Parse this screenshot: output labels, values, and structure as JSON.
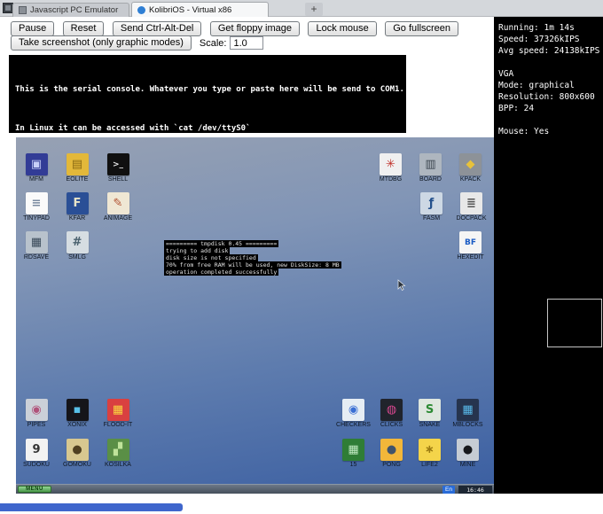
{
  "browser": {
    "tabs": [
      {
        "label": "Javascript PC Emulator",
        "active": false
      },
      {
        "label": "KolibriOS - Virtual x86",
        "active": true
      }
    ],
    "new_tab_label": "+"
  },
  "toolbar": {
    "pause": "Pause",
    "reset": "Reset",
    "send_cad": "Send Ctrl-Alt-Del",
    "get_floppy": "Get floppy image",
    "lock_mouse": "Lock mouse",
    "go_fullscreen": "Go fullscreen",
    "take_screenshot": "Take screenshot (only graphic modes)",
    "scale_label": "Scale:",
    "scale_value": "1.0"
  },
  "serial_console": {
    "line1": "This is the serial console. Whatever you type or paste here will be send to COM1.",
    "line2": "In Linux it can be accessed with `cat /dev/ttyS0`"
  },
  "stats": {
    "running": "Running: 1m 14s",
    "speed": "Speed: 37326kIPS",
    "avg_speed": "Avg speed: 24138kIPS",
    "vga_header": "VGA",
    "mode": "Mode: graphical",
    "resolution": "Resolution: 800x600",
    "bpp": "BPP: 24",
    "mouse": "Mouse: Yes"
  },
  "desktop": {
    "boot_messages": [
      "========= tmpdisk 0.45 =========",
      "trying to add disk",
      "disk size is not specified",
      "70% from free RAM will be used, new DiskSize: 8 MB",
      "operation completed successfully"
    ],
    "icon_groups": {
      "top_left": [
        {
          "label": "MFM",
          "icon": "floppy",
          "glyph": "▣",
          "bg": "#323c96",
          "fg": "#c8d0f8"
        },
        {
          "label": "EOLITE",
          "icon": "folder",
          "glyph": "▤",
          "bg": "#e3b83a",
          "fg": "#8a6a14"
        },
        {
          "label": "SHELL",
          "icon": "terminal",
          "glyph": ">_",
          "bg": "#101010",
          "fg": "#e8e8e8"
        },
        {
          "label": "TINYPAD",
          "icon": "notepad",
          "glyph": "≡",
          "bg": "#fafafa",
          "fg": "#7a8aa0"
        },
        {
          "label": "KFAR",
          "icon": "file-manager",
          "glyph": "F",
          "bg": "#2a4f96",
          "fg": "#e8e4c8"
        },
        {
          "label": "ANIMAGE",
          "icon": "paint",
          "glyph": "✎",
          "bg": "#efe7d4",
          "fg": "#b05030"
        },
        {
          "label": "RDSAVE",
          "icon": "disk-save",
          "glyph": "▦",
          "bg": "#b8c2cc",
          "fg": "#384858"
        },
        {
          "label": "SMLG",
          "icon": "grid-app",
          "glyph": "#",
          "bg": "#d6dde2",
          "fg": "#49606e"
        }
      ],
      "top_right_row1": [
        {
          "label": "MTDBG",
          "icon": "debugger",
          "glyph": "✳",
          "bg": "#f0f0f0",
          "fg": "#c03028"
        },
        {
          "label": "BOARD",
          "icon": "board",
          "glyph": "▥",
          "bg": "#aeb6bf",
          "fg": "#3c4650"
        },
        {
          "label": "KPACK",
          "icon": "packer",
          "glyph": "◆",
          "bg": "#8d9298",
          "fg": "#e8c23a"
        }
      ],
      "top_right_row2": [
        {
          "label": "FASM",
          "icon": "assembler",
          "glyph": "ƒ",
          "bg": "#cdd8e4",
          "fg": "#23508c"
        },
        {
          "label": "DOCPACK",
          "icon": "docs-pack",
          "glyph": "≣",
          "bg": "#e8e8e8",
          "fg": "#555555"
        }
      ],
      "top_right_row3": [
        {
          "label": "HEXEDIT",
          "icon": "hex-editor",
          "glyph": "BF",
          "bg": "#f5f5f5",
          "fg": "#1a5bc4"
        }
      ],
      "bottom_left": [
        {
          "label": "PIPES",
          "icon": "pipes-game",
          "glyph": "◉",
          "bg": "#cbd0d8",
          "fg": "#b0527a"
        },
        {
          "label": "XONIX",
          "icon": "xonix-game",
          "glyph": "▪",
          "bg": "#15151a",
          "fg": "#58c0e8"
        },
        {
          "label": "FLOOD-IT",
          "icon": "flood-it-game",
          "glyph": "▦",
          "bg": "#d94040",
          "fg": "#f8d840"
        },
        {
          "label": "SUDOKU",
          "icon": "sudoku-game",
          "glyph": "9",
          "bg": "#f2f2f2",
          "fg": "#333333"
        },
        {
          "label": "GOMOKU",
          "icon": "gomoku-game",
          "glyph": "●",
          "bg": "#d8c890",
          "fg": "#504020"
        },
        {
          "label": "KOSILKA",
          "icon": "kosilka-game",
          "glyph": "▞",
          "bg": "#5a8f46",
          "fg": "#bfe39a"
        }
      ],
      "bottom_right": [
        {
          "label": "CHECKERS",
          "icon": "checkers-game",
          "glyph": "◉",
          "bg": "#e6edf4",
          "fg": "#3b6fd4"
        },
        {
          "label": "CLICKS",
          "icon": "clicks-game",
          "glyph": "◍",
          "bg": "#20242c",
          "fg": "#d84890"
        },
        {
          "label": "SNAKE",
          "icon": "snake-game",
          "glyph": "S",
          "bg": "#dfe7df",
          "fg": "#2c8a34"
        },
        {
          "label": "MBLOCKS",
          "icon": "mblocks-game",
          "glyph": "▦",
          "bg": "#26344e",
          "fg": "#58b8e8"
        },
        {
          "label": "15",
          "icon": "fifteen-game",
          "glyph": "▦",
          "bg": "#2f7d36",
          "fg": "#bfe8c0"
        },
        {
          "label": "PONG",
          "icon": "pong-game",
          "glyph": "●",
          "bg": "#f2b73a",
          "fg": "#40536b"
        },
        {
          "label": "LIFE2",
          "icon": "life2-game",
          "glyph": "∗",
          "bg": "#f4d44a",
          "fg": "#9a7a10"
        },
        {
          "label": "MINE",
          "icon": "mine-game",
          "glyph": "●",
          "bg": "#c6ccd4",
          "fg": "#17181c"
        }
      ]
    },
    "taskbar": {
      "menu_label": "MENU",
      "language": "En",
      "clock": "16:46"
    }
  },
  "colors": {
    "desktop_gradient_top": "#97a1b3",
    "desktop_gradient_bottom": "#3a5ea1",
    "menu_button_green": "#4a9a4a",
    "language_badge_blue": "#2a6cd8",
    "bottom_bar_blue": "#3f66cc"
  }
}
